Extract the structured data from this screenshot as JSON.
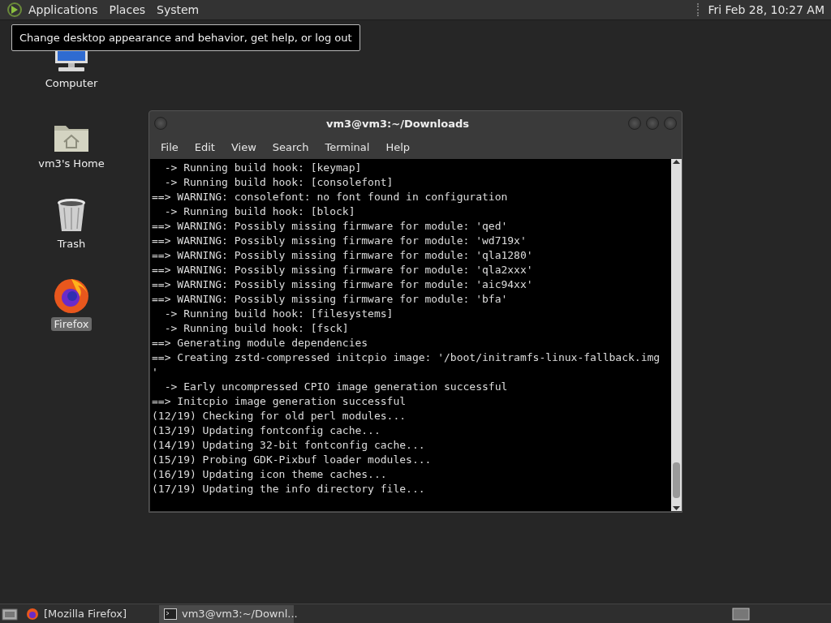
{
  "top_panel": {
    "menus": [
      {
        "label": "Applications"
      },
      {
        "label": "Places"
      },
      {
        "label": "System"
      }
    ],
    "clock": "Fri Feb 28, 10:27 AM"
  },
  "tooltip": "Change desktop appearance and behavior, get help, or log out",
  "desktop_icons": [
    {
      "label": "Computer",
      "kind": "computer",
      "selected": false
    },
    {
      "label": "vm3's Home",
      "kind": "home",
      "selected": false
    },
    {
      "label": "Trash",
      "kind": "trash",
      "selected": false
    },
    {
      "label": "Firefox",
      "kind": "firefox",
      "selected": true
    }
  ],
  "terminal": {
    "title": "vm3@vm3:~/Downloads",
    "menus": [
      "File",
      "Edit",
      "View",
      "Search",
      "Terminal",
      "Help"
    ],
    "lines": [
      "  -> Running build hook: [keymap]",
      "  -> Running build hook: [consolefont]",
      "==> WARNING: consolefont: no font found in configuration",
      "  -> Running build hook: [block]",
      "==> WARNING: Possibly missing firmware for module: 'qed'",
      "==> WARNING: Possibly missing firmware for module: 'wd719x'",
      "==> WARNING: Possibly missing firmware for module: 'qla1280'",
      "==> WARNING: Possibly missing firmware for module: 'qla2xxx'",
      "==> WARNING: Possibly missing firmware for module: 'aic94xx'",
      "==> WARNING: Possibly missing firmware for module: 'bfa'",
      "  -> Running build hook: [filesystems]",
      "  -> Running build hook: [fsck]",
      "==> Generating module dependencies",
      "==> Creating zstd-compressed initcpio image: '/boot/initramfs-linux-fallback.img",
      "'",
      "  -> Early uncompressed CPIO image generation successful",
      "==> Initcpio image generation successful",
      "(12/19) Checking for old perl modules...",
      "(13/19) Updating fontconfig cache...",
      "(14/19) Updating 32-bit fontconfig cache...",
      "(15/19) Probing GDK-Pixbuf loader modules...",
      "(16/19) Updating icon theme caches...",
      "(17/19) Updating the info directory file..."
    ]
  },
  "taskbar": {
    "tasks": [
      {
        "label": "[Mozilla Firefox]",
        "kind": "firefox",
        "selected": false
      },
      {
        "label": "vm3@vm3:~/Downl...",
        "kind": "terminal",
        "selected": true
      }
    ]
  }
}
